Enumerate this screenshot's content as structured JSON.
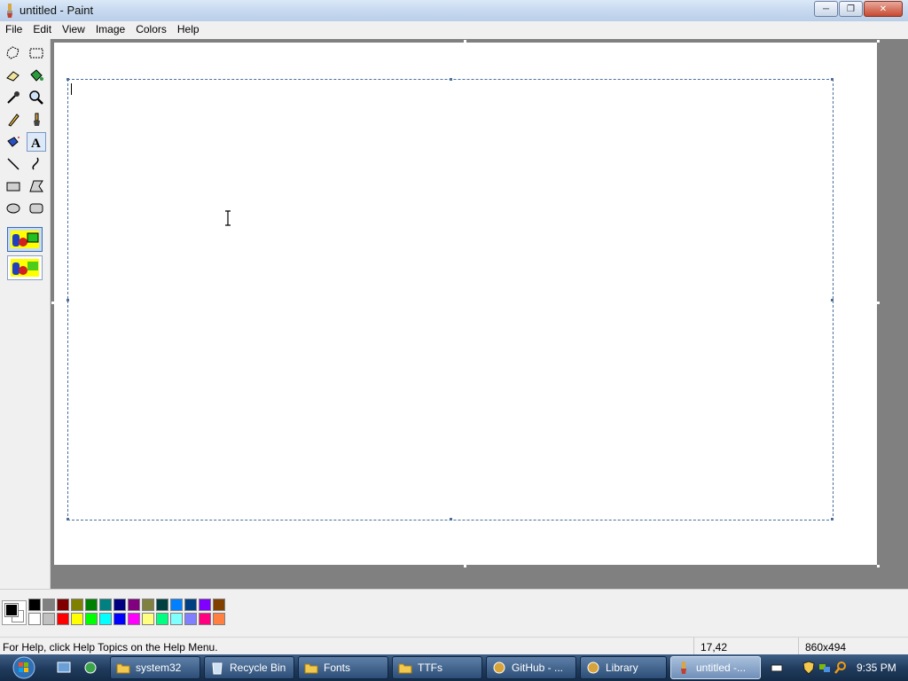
{
  "window": {
    "title": "untitled - Paint"
  },
  "menu": {
    "items": [
      "File",
      "Edit",
      "View",
      "Image",
      "Colors",
      "Help"
    ]
  },
  "toolbox": {
    "tools": [
      "free-form-select",
      "rectangle-select",
      "eraser",
      "fill-with-color",
      "pick-color",
      "magnifier",
      "pencil",
      "brush",
      "airbrush",
      "text",
      "line",
      "curve",
      "rectangle",
      "polygon",
      "ellipse",
      "rounded-rectangle"
    ],
    "active_tool": "text"
  },
  "palette": {
    "foreground": "#000000",
    "background": "#ffffff",
    "colors": [
      "#000000",
      "#808080",
      "#800000",
      "#808000",
      "#008000",
      "#008080",
      "#000080",
      "#800080",
      "#808040",
      "#004040",
      "#0080ff",
      "#004080",
      "#8000ff",
      "#804000",
      "#ffffff",
      "#c0c0c0",
      "#ff0000",
      "#ffff00",
      "#00ff00",
      "#00ffff",
      "#0000ff",
      "#ff00ff",
      "#ffff80",
      "#00ff80",
      "#80ffff",
      "#8080ff",
      "#ff0080",
      "#ff8040"
    ]
  },
  "status": {
    "help": "For Help, click Help Topics on the Help Menu.",
    "coords": "17,42",
    "size": "860x494"
  },
  "taskbar": {
    "tasks": [
      "system32",
      "Recycle Bin",
      "Fonts",
      "TTFs",
      "GitHub - ...",
      "Library",
      "untitled -..."
    ],
    "active_task": "untitled -...",
    "clock": "9:35 PM"
  }
}
